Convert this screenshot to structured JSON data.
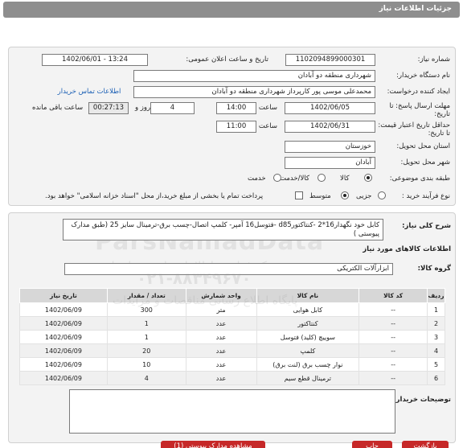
{
  "header": {
    "title": "جزئیات اطلاعات نیاز"
  },
  "info": {
    "need_number_label": "شماره نیاز:",
    "need_number": "1102094899000301",
    "announce_label": "تاریخ و ساعت اعلان عمومی:",
    "announce_value": "1402/06/01 - 13:24",
    "org_label": "نام دستگاه خریدار:",
    "org_value": "شهرداری منطقه دو آبادان",
    "creator_label": "ایجاد کننده درخواست:",
    "creator_value": "محمدعلی موسی پور کارپرداز شهرداری منطقه دو آبادان",
    "contact_link": "اطلاعات تماس خریدار",
    "deadline_label": "مهلت ارسال پاسخ: تا تاریخ:",
    "deadline_date": "1402/06/05",
    "time_label": "ساعت",
    "deadline_time": "14:00",
    "days_value": "4",
    "days_label": "روز و",
    "remaining_time": "00:27:13",
    "remaining_label": "ساعت باقی مانده",
    "validity_label": "حداقل تاریخ اعتبار قیمت: تا تاریخ:",
    "validity_date": "1402/06/31",
    "validity_time_label": "ساعت",
    "validity_time": "11:00",
    "province_label": "استان محل تحویل:",
    "province_value": "خوزستان",
    "city_label": "شهر محل تحویل:",
    "city_value": "آبادان",
    "category_label": "طبقه بندی موضوعی:",
    "category_options": [
      "کالا",
      "کالا/خدمت",
      "خدمت"
    ],
    "category_selected": "کالا",
    "process_label": "نوع فرآیند خرید :",
    "process_options": [
      "جزیی",
      "متوسط"
    ],
    "process_selected": "متوسط",
    "payment_note": "پرداخت تمام یا بخشی از مبلغ خرید،از محل \"اسناد خزانه اسلامی\" خواهد بود."
  },
  "summary": {
    "label": "شرح کلی نیاز:",
    "text": "کابل خود نگهدار16*2 -کنتاکتورd85 -فتوسل16 آمپر- کلمپ اتصال-چسب برق-ترمینال سایز 25 (طبق مدارک پیوستی )"
  },
  "goods_section_title": "اطلاعات کالاهای مورد نیاز",
  "group": {
    "label": "گروه کالا:",
    "value": "ابزارآلات الکتریکی"
  },
  "table": {
    "headers": [
      "ردیف",
      "کد کالا",
      "نام کالا",
      "واحد شمارش",
      "تعداد / مقدار",
      "تاریخ نیاز"
    ],
    "rows": [
      [
        "1",
        "--",
        "کابل هوایی",
        "متر",
        "300",
        "1402/06/09"
      ],
      [
        "2",
        "--",
        "کنتاکتور",
        "عدد",
        "1",
        "1402/06/09"
      ],
      [
        "3",
        "--",
        "سوییچ (کلید) فتوسل",
        "عدد",
        "1",
        "1402/06/09"
      ],
      [
        "4",
        "--",
        "کلمپ",
        "عدد",
        "20",
        "1402/06/09"
      ],
      [
        "5",
        "--",
        "نوار چسب برق (لنت برق)",
        "عدد",
        "10",
        "1402/06/09"
      ],
      [
        "6",
        "--",
        "ترمینال قطع سیم",
        "عدد",
        "4",
        "1402/06/09"
      ]
    ]
  },
  "buyer_notes_label": "توضیحات خریدار:",
  "bottom_buttons": {
    "back": "بازگشت",
    "print": "چاپ",
    "attachments": "مشاهده مدارک پیوستی (1)"
  },
  "watermark": {
    "brand": "ParsNamadData",
    "line1": "مرکز فراوری اطلاعات پارس نماد داده",
    "line2": "پایگاه اطلاع رسانی مناقصات و مزایدات",
    "phone": "۰۲۱-۸۸۳۴۹۶۷۰"
  },
  "colors": {
    "titlebar": "#8e8e8e",
    "red_button": "#c62828",
    "link": "#1a5fb4"
  }
}
